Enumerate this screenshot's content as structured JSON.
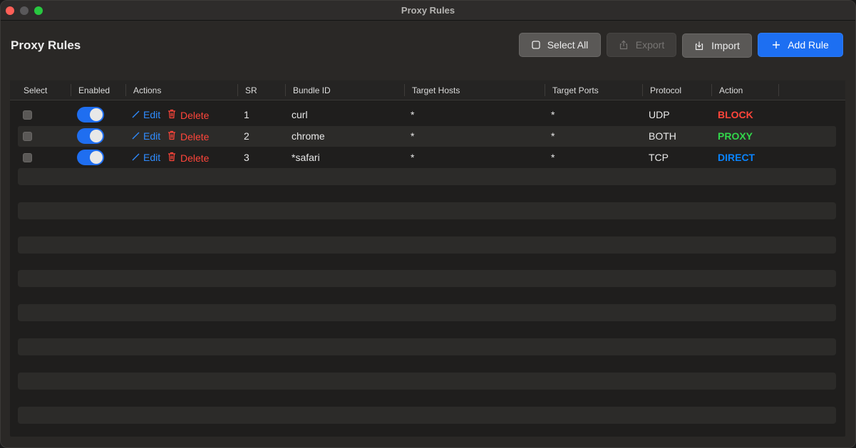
{
  "window": {
    "title": "Proxy Rules"
  },
  "page": {
    "title": "Proxy Rules"
  },
  "toolbar": {
    "select_all_label": "Select All",
    "export_label": "Export",
    "import_label": "Import",
    "add_rule_label": "Add Rule"
  },
  "table": {
    "columns": [
      "Select",
      "Enabled",
      "Actions",
      "SR",
      "Bundle ID",
      "Target Hosts",
      "Target Ports",
      "Protocol",
      "Action"
    ],
    "edit_label": "Edit",
    "delete_label": "Delete",
    "rows": [
      {
        "enabled": true,
        "sr": "1",
        "bundle_id": "curl",
        "target_hosts": "*",
        "target_ports": "*",
        "protocol": "UDP",
        "action": "BLOCK"
      },
      {
        "enabled": true,
        "sr": "2",
        "bundle_id": "chrome",
        "target_hosts": "*",
        "target_ports": "*",
        "protocol": "BOTH",
        "action": "PROXY"
      },
      {
        "enabled": true,
        "sr": "3",
        "bundle_id": "*safari",
        "target_hosts": "*",
        "target_ports": "*",
        "protocol": "TCP",
        "action": "DIRECT"
      }
    ]
  },
  "colors": {
    "BLOCK": "#ff453a",
    "PROXY": "#32d74b",
    "DIRECT": "#0a84ff",
    "accent": "#1d6ff2"
  },
  "icons": {
    "select_all": "checkbox-icon",
    "export": "export-icon",
    "import": "import-icon",
    "add_rule": "plus-icon",
    "edit": "pencil-icon",
    "delete": "trash-icon"
  }
}
